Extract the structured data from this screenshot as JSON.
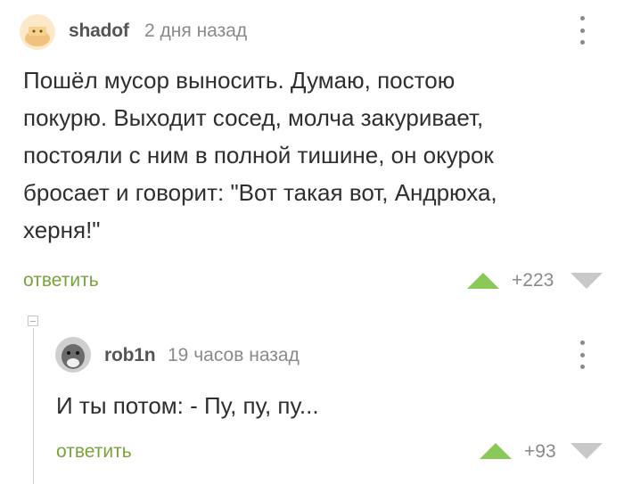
{
  "comments": [
    {
      "author": "shadof",
      "time": "2 дня назад",
      "lines": [
        "Пошёл мусор выносить. Думаю, постою",
        "покурю. Выходит сосед, молча закуривает,",
        "постояли с ним в полной тишине, он окурок",
        "бросает и говорит: \"Вот такая вот, Андрюха,",
        "херня!\""
      ],
      "reply_label": "ответить",
      "score": "+223"
    },
    {
      "author": "rob1n",
      "time": "19 часов назад",
      "lines": [
        "И ты потом: - Пу, пу, пу..."
      ],
      "reply_label": "ответить",
      "score": "+93"
    }
  ],
  "colors": {
    "accent_green": "#7aa33c",
    "upvote": "#8ac858",
    "downvote": "#c8c8c8",
    "muted": "#8a8a8a"
  },
  "icons": [
    "avatar-shadof",
    "avatar-rob1n",
    "kebab-menu-icon",
    "upvote-arrow-icon",
    "downvote-arrow-icon",
    "collapse-thread-icon"
  ]
}
